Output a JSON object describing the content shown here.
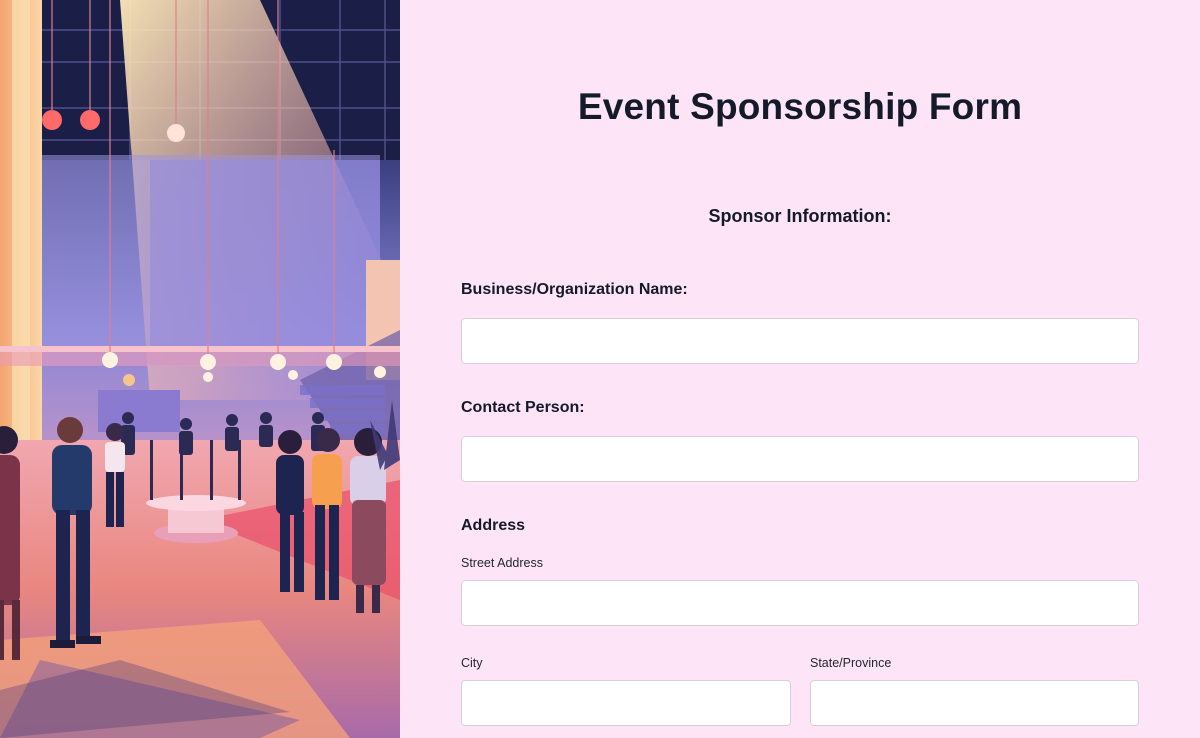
{
  "form": {
    "title": "Event Sponsorship Form",
    "section_heading": "Sponsor Information:",
    "fields": {
      "business_name": {
        "label": "Business/Organization Name:",
        "value": "",
        "placeholder": ""
      },
      "contact_person": {
        "label": "Contact Person:",
        "value": "",
        "placeholder": ""
      }
    },
    "address": {
      "heading": "Address",
      "street": {
        "label": "Street Address",
        "value": "",
        "placeholder": ""
      },
      "city": {
        "label": "City",
        "value": "",
        "placeholder": ""
      },
      "state": {
        "label": "State/Province",
        "value": "",
        "placeholder": ""
      }
    }
  },
  "colors": {
    "form_background": "#fde5f7",
    "text": "#141a2a",
    "input_border": "#d7cfd6"
  },
  "hero": {
    "image": "event-venue-illustration"
  }
}
